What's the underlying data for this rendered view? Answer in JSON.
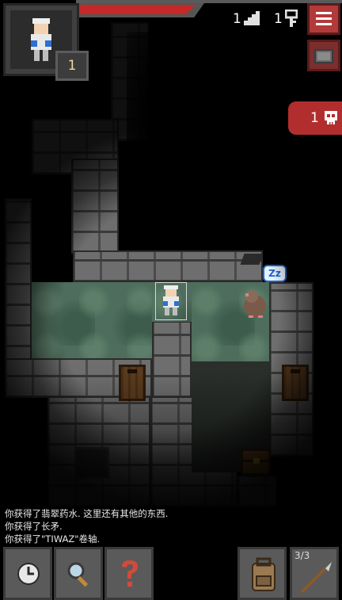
{
  "hud": {
    "level": "1",
    "depth": "1",
    "keys": "1",
    "danger_count": "1",
    "hp_fraction": 0.93
  },
  "enemy": {
    "name_label": "Zz"
  },
  "log": [
    "你获得了翡翠药水. 这里还有其他的东西.",
    "你获得了长矛.",
    "你获得了\"TIWAZ\"卷轴."
  ],
  "toolbar": {
    "quickslot_uses": "3/3",
    "buttons": [
      "wait-icon",
      "search-icon",
      "examine-icon",
      "backpack-icon",
      "spear-icon"
    ]
  },
  "icons": {
    "depth": "stairs-icon",
    "keys": "key-icon",
    "danger": "skull-icon",
    "menu": "menu-icon",
    "journal": "journal-icon"
  },
  "colors": {
    "hp": "#c62828",
    "menu": "#b23a3a",
    "danger": "#b22e2e",
    "floor": "#4e6d5c"
  }
}
